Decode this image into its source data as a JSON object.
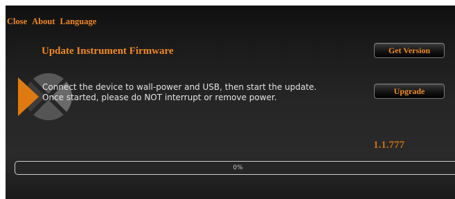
{
  "menu": {
    "items": [
      {
        "label": "Close"
      },
      {
        "label": "About"
      },
      {
        "label": "Language"
      }
    ]
  },
  "main": {
    "title": "Update Instrument Firmware",
    "instructions": "Connect the device to wall-power and USB, then start the update.  Once started, please do NOT interrupt or remove power.",
    "version": "1.1.777"
  },
  "buttons": {
    "get_version": "Get Version",
    "upgrade": "Upgrade"
  },
  "progress": {
    "value": 0,
    "label": "0%"
  },
  "logo": {
    "icon": "x-logo-icon"
  },
  "colors": {
    "accent": "#f08a1c",
    "accent_dark": "#c86f10",
    "text": "#e4e4e4",
    "background": "#232323"
  }
}
